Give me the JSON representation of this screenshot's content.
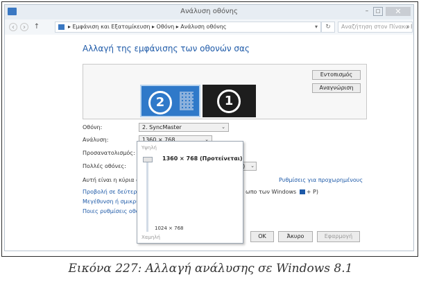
{
  "window": {
    "title": "Ανάλυση οθόνης",
    "controls": {
      "minimize": "–",
      "maximize": "□",
      "close": "✕"
    }
  },
  "address_bar": {
    "breadcrumb": "▸ Εμφάνιση και Εξατομίκευση  ▸  Οθόνη  ▸  Ανάλυση οθόνης",
    "dropdown_glyph": "▾",
    "refresh_glyph": "↻",
    "search_placeholder": "Αναζήτηση στον Πίνακα Ελέγ...",
    "search_icon": "⌕"
  },
  "page": {
    "heading": "Αλλαγή της εμφάνισης των οθονών σας",
    "preview": {
      "monitor_2": "2",
      "monitor_1": "1",
      "detect_label": "Εντοπισμός",
      "identify_label": "Αναγνώριση"
    },
    "fields": {
      "display_label": "Οθόνη:",
      "display_value": "2. SyncMaster",
      "resolution_label": "Ανάλυση:",
      "resolution_value": "1360 × 768 (Προτείνεται)",
      "orientation_label": "Προσανατολισμός:",
      "multiple_label": "Πολλές οθόνες:",
      "multiple_value_tail": "η)"
    },
    "dropdown_arrow": "⌄",
    "main_display_text": "Αυτή είναι η κύρια οθ",
    "advanced_link": "Ρυθμίσεις για προχωρημένους",
    "links": {
      "project_link": "Προβολή σε δεύτερη",
      "project_tail": "ωπο των Windows",
      "project_shortcut": "+ P)",
      "enlarge_link": "Μεγέθυνση ή σμικρυ",
      "which_settings_link": "Ποιες ρυθμίσεις οθό"
    },
    "buttons": {
      "ok": "OK",
      "cancel": "Άκυρο",
      "apply": "Εφαρμογή"
    }
  },
  "resolution_popup": {
    "high_label": "Υψηλή",
    "low_label": "Χαμηλή",
    "top_resolution": "1360 × 768 (Προτείνεται)",
    "bottom_resolution": "1024 × 768",
    "slider_level": 1.0
  },
  "caption": "Εικόνα 227: Αλλαγή ανάλυσης σε Windows 8.1"
}
